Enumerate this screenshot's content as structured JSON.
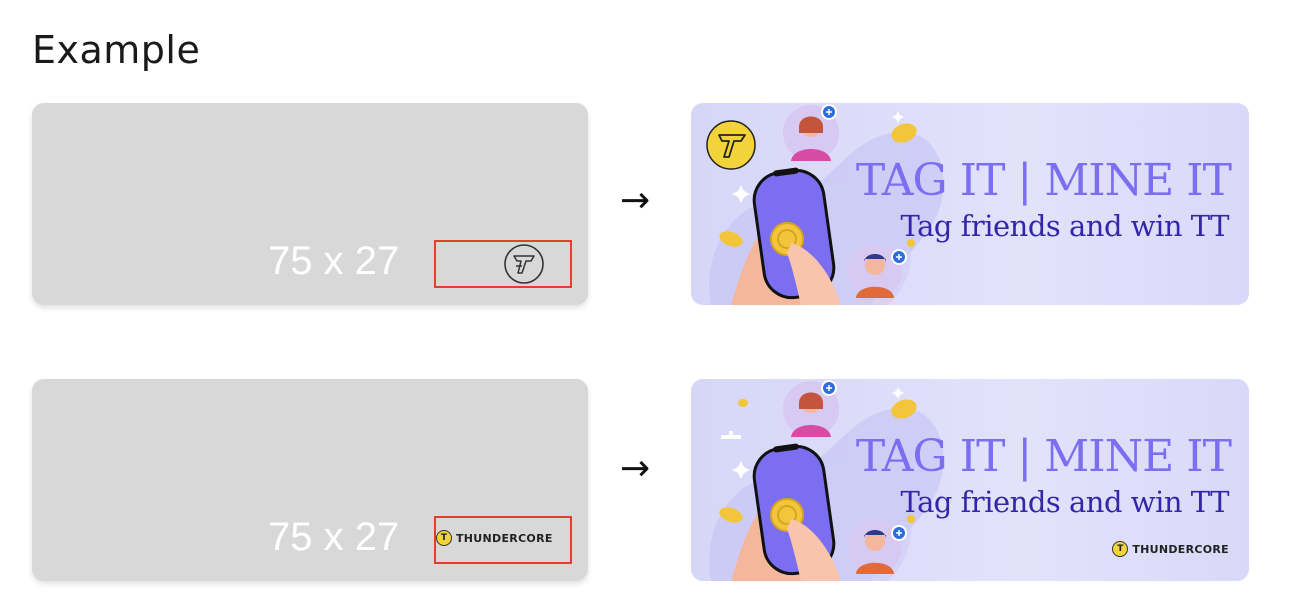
{
  "heading": "Example",
  "examples": [
    {
      "placeholder": {
        "size_label": "75 x 27",
        "logo_type": "thundercore-circle-icon"
      },
      "arrow": "→",
      "banner": {
        "title": "TAG IT | MINE IT",
        "subtitle": "Tag friends and win TT",
        "logo_type": "thundercore-circle-icon"
      }
    },
    {
      "placeholder": {
        "size_label": "75 x 27",
        "logo_type": "thundercore-wordmark",
        "logo_text": "THUNDERCORE"
      },
      "arrow": "→",
      "banner": {
        "title": "TAG IT | MINE IT",
        "subtitle": "Tag friends and win TT",
        "logo_type": "thundercore-wordmark",
        "logo_text": "THUNDERCORE"
      }
    }
  ],
  "colors": {
    "placeholder_bg": "#d8d8d8",
    "highlight_box": "#e0402c",
    "title_color": "#7b6ef0",
    "subtitle_color": "#3326a8",
    "coin_yellow": "#f3d33a"
  }
}
